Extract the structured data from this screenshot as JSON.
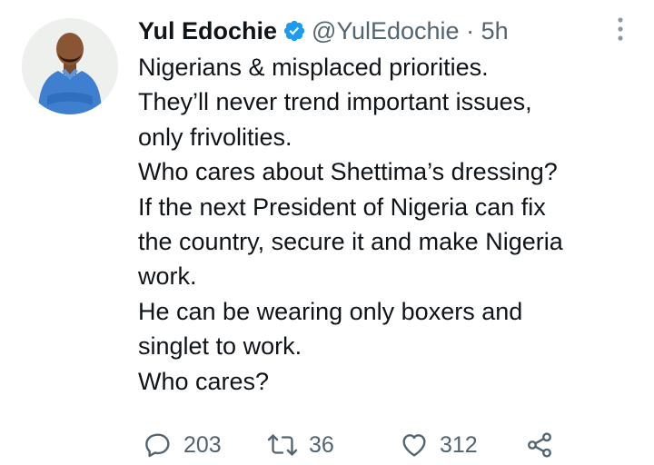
{
  "tweet": {
    "author": {
      "display_name": "Yul Edochie",
      "handle": "@YulEdochie",
      "verified": true,
      "avatar_icon": "profile-photo"
    },
    "separator": "·",
    "timestamp": "5h",
    "lines": [
      "Nigerians & misplaced priorities.",
      "They’ll never trend important issues,",
      "only frivolities.",
      "Who cares about Shettima’s dressing?",
      "If the next President of Nigeria can fix",
      "the country, secure it and make Nigeria",
      "work.",
      "He can be wearing only boxers and",
      "singlet to work.",
      "Who cares?"
    ],
    "actions": {
      "reply": {
        "icon": "reply-icon",
        "count": "203"
      },
      "retweet": {
        "icon": "retweet-icon",
        "count": "36"
      },
      "like": {
        "icon": "heart-icon",
        "count": "312"
      },
      "share": {
        "icon": "share-icon"
      }
    },
    "more_icon": "more-vertical-icon"
  },
  "colors": {
    "text_primary": "#0f1419",
    "text_secondary": "#536471",
    "verified_badge": "#1d9bf0",
    "background": "#ffffff"
  }
}
